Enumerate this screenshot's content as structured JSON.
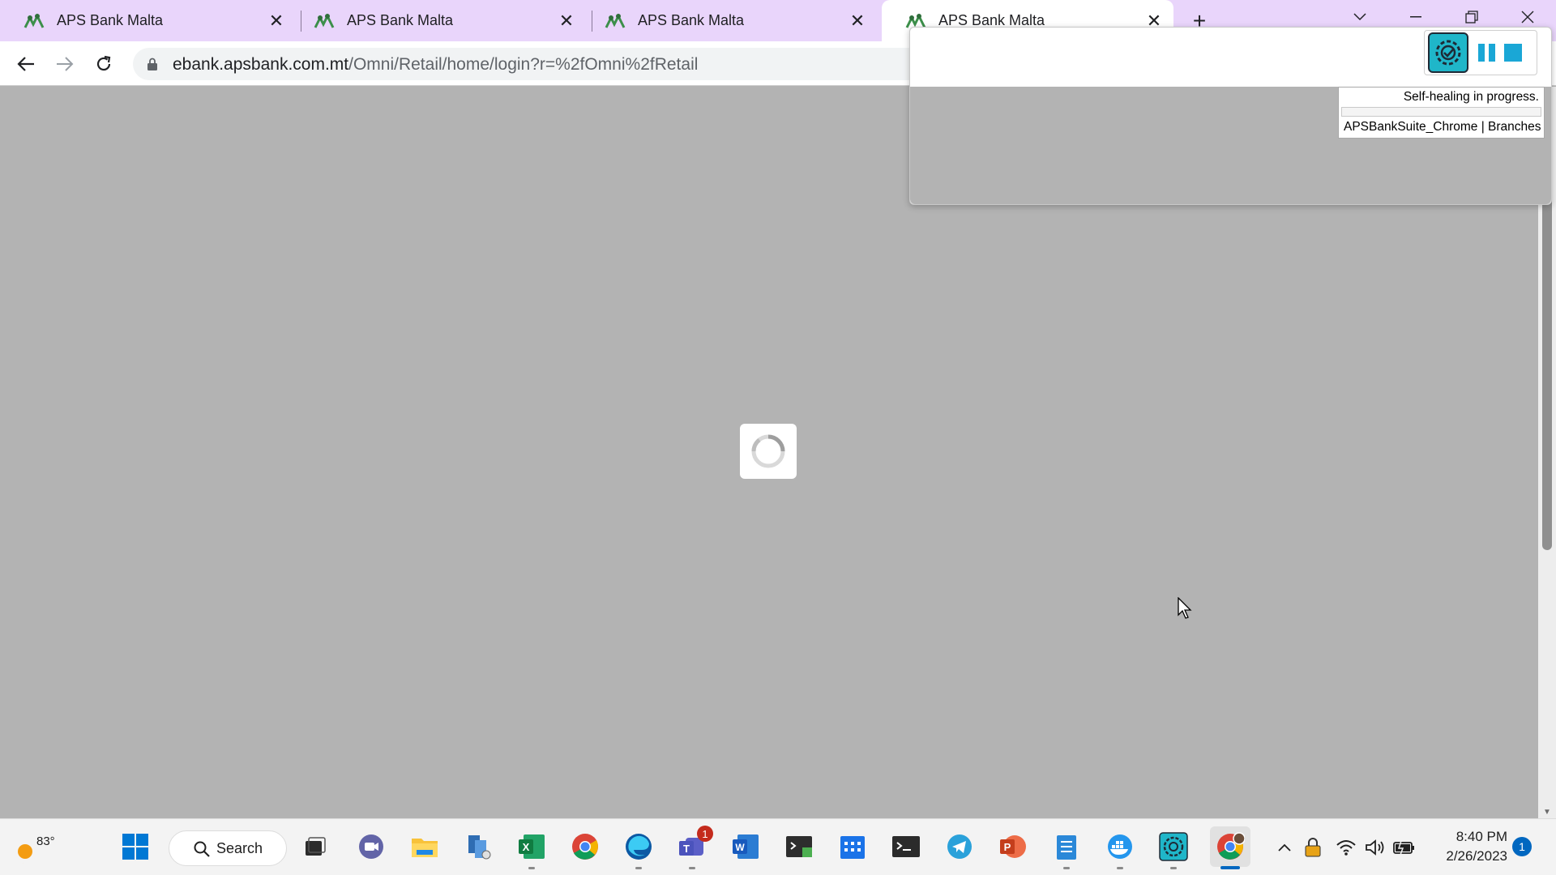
{
  "browser": {
    "tabs": [
      {
        "title": "APS Bank Malta",
        "active": false
      },
      {
        "title": "APS Bank Malta",
        "active": false
      },
      {
        "title": "APS Bank Malta",
        "active": false
      },
      {
        "title": "APS Bank Malta",
        "active": true
      }
    ],
    "url_host": "ebank.apsbank.com.mt",
    "url_path": "/Omni/Retail/home/login?r=%2fOmni%2fRetail"
  },
  "extension": {
    "status_text": "Self-healing in progress.",
    "info_text": "APSBankSuite_Chrome | Branches",
    "progress": 0
  },
  "taskbar": {
    "weather_temp": "83°",
    "search_label": "Search",
    "teams_badge": "1",
    "time": "8:40 PM",
    "date": "2/26/2023",
    "notification_count": "1"
  },
  "colors": {
    "tabstrip_bg": "#e9d5fb",
    "page_overlay": "#b3b3b3",
    "accent": "#1aa7d6"
  }
}
